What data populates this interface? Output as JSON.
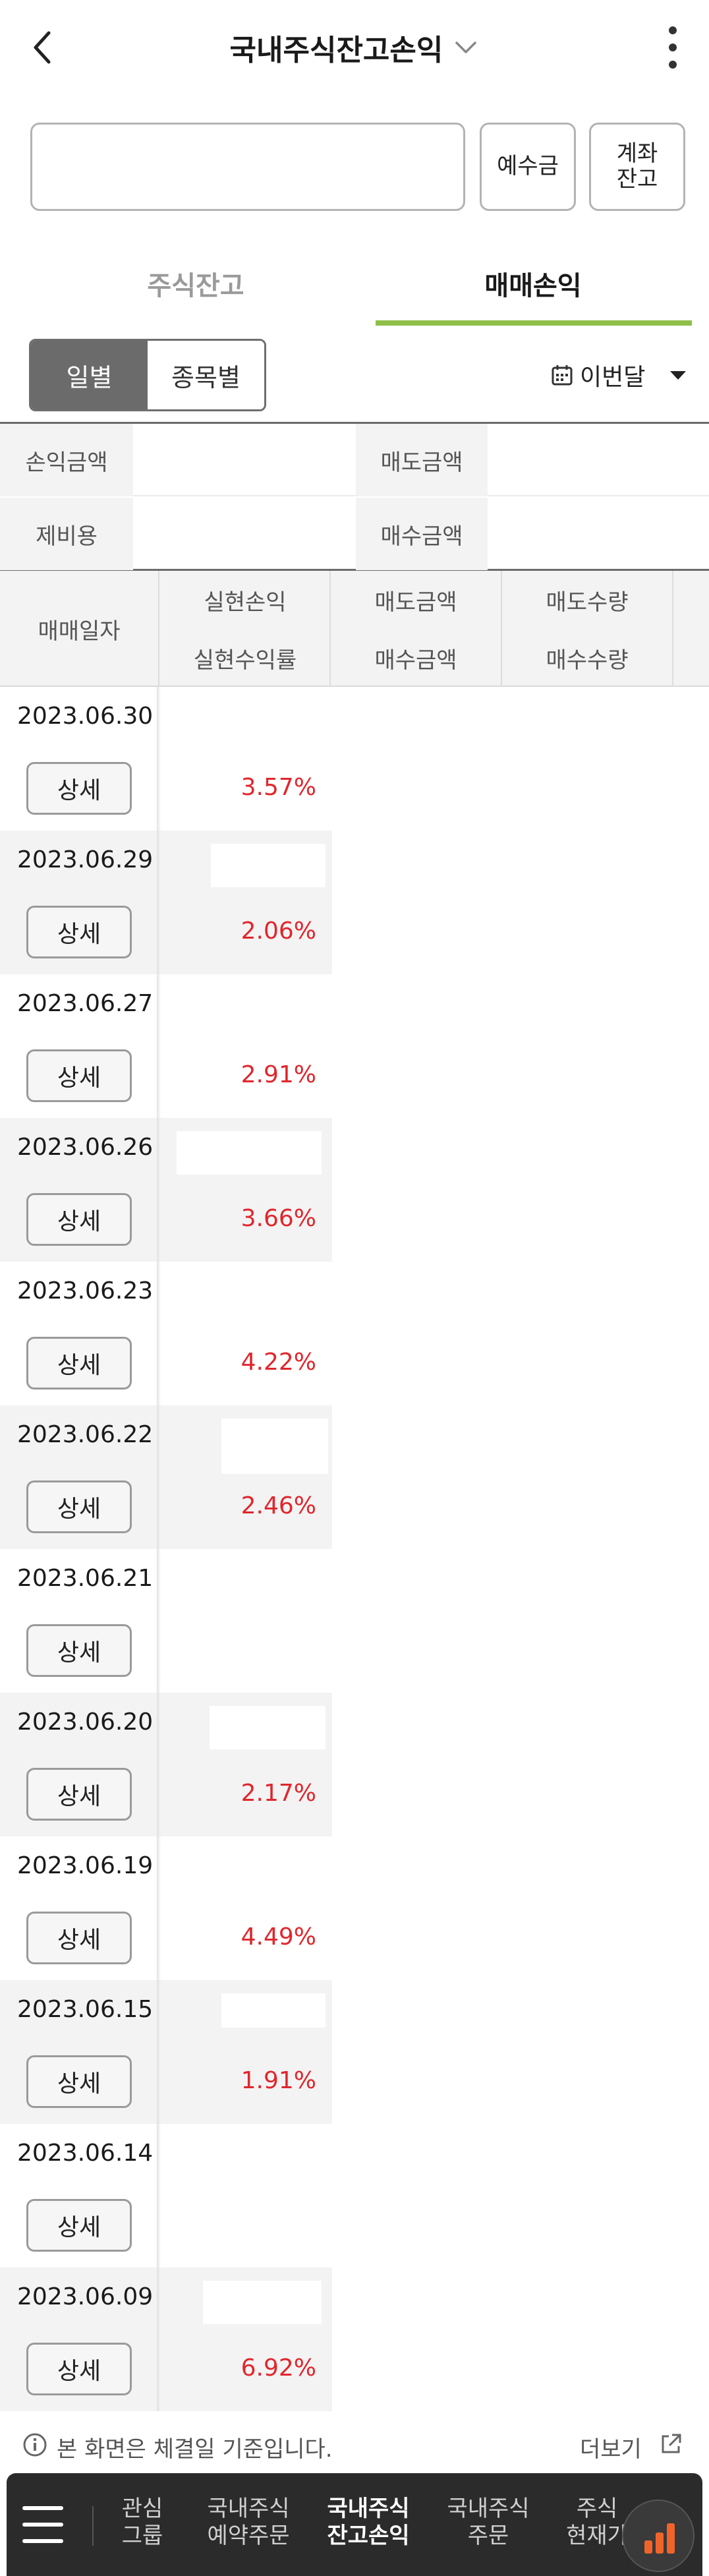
{
  "header": {
    "title": "국내주식잔고손익"
  },
  "account": {
    "deposit_button": "예수금",
    "account_button_line1": "계좌",
    "account_button_line2": "잔고"
  },
  "tabs": [
    {
      "label": "주식잔고"
    },
    {
      "label": "매매손익"
    }
  ],
  "segment": {
    "daily": "일별",
    "by_stock": "종목별"
  },
  "period": {
    "label": "이번달"
  },
  "summary": {
    "pl_amount_label": "손익금액",
    "sell_amount_label": "매도금액",
    "fees_label": "제비용",
    "buy_amount_label": "매수금액"
  },
  "table_header": {
    "trade_date": "매매일자",
    "realized_pl": "실현손익",
    "realized_rate": "실현수익률",
    "sell_amount": "매도금액",
    "buy_amount": "매수금액",
    "sell_qty": "매도수량",
    "buy_qty": "매수수량"
  },
  "detail_label": "상세",
  "rows": [
    {
      "date": "2023.06.30",
      "rate": "3.57%"
    },
    {
      "date": "2023.06.29",
      "rate": "2.06%"
    },
    {
      "date": "2023.06.27",
      "rate": "2.91%"
    },
    {
      "date": "2023.06.26",
      "rate": "3.66%"
    },
    {
      "date": "2023.06.23",
      "rate": "4.22%"
    },
    {
      "date": "2023.06.22",
      "rate": "2.46%"
    },
    {
      "date": "2023.06.21",
      "rate": ""
    },
    {
      "date": "2023.06.20",
      "rate": "2.17%"
    },
    {
      "date": "2023.06.19",
      "rate": "4.49%"
    },
    {
      "date": "2023.06.15",
      "rate": "1.91%"
    },
    {
      "date": "2023.06.14",
      "rate": ""
    },
    {
      "date": "2023.06.09",
      "rate": "6.92%"
    }
  ],
  "footer": {
    "info_text": "본 화면은 체결일 기준입니다.",
    "more_link": "더보기"
  },
  "bottom_nav": {
    "items": [
      {
        "line1": "관심",
        "line2": "그룹"
      },
      {
        "line1": "국내주식",
        "line2": "예약주문"
      },
      {
        "line1": "국내주식",
        "line2": "잔고손익"
      },
      {
        "line1": "국내주식",
        "line2": "주문"
      },
      {
        "line1": "주식",
        "line2": "현재가"
      }
    ]
  },
  "colors": {
    "accent_green": "#8fbf4a",
    "profit_red": "#e0262c",
    "nav_bg": "#2b2b2b",
    "fab_orange": "#f0642a"
  }
}
